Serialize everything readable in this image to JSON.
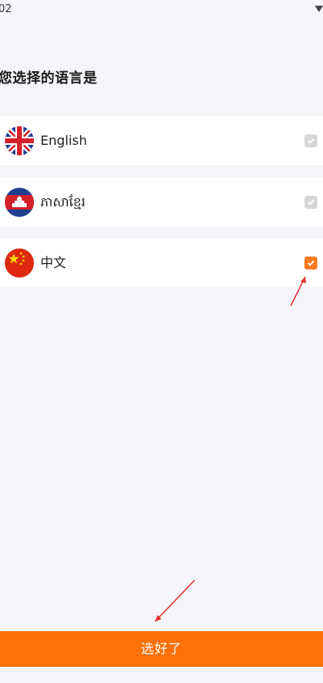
{
  "status_bar": {
    "time": "02",
    "signal_icon": "wifi-icon"
  },
  "title": "您选择的语言是",
  "languages": [
    {
      "label": "English",
      "flag_icon": "uk-flag-icon",
      "checked": false
    },
    {
      "label": "ភាសាខ្មែរ",
      "flag_icon": "cambodia-flag-icon",
      "checked": false
    },
    {
      "label": "中文",
      "flag_icon": "china-flag-icon",
      "checked": true
    }
  ],
  "confirm_button": {
    "label": "选好了"
  },
  "colors": {
    "accent": "#fd7107",
    "checkbox_checked": "#fa7a23",
    "checkbox_unchecked": "#d6d6d6",
    "background": "#f5f5f9",
    "annotation": "#e0302a"
  }
}
